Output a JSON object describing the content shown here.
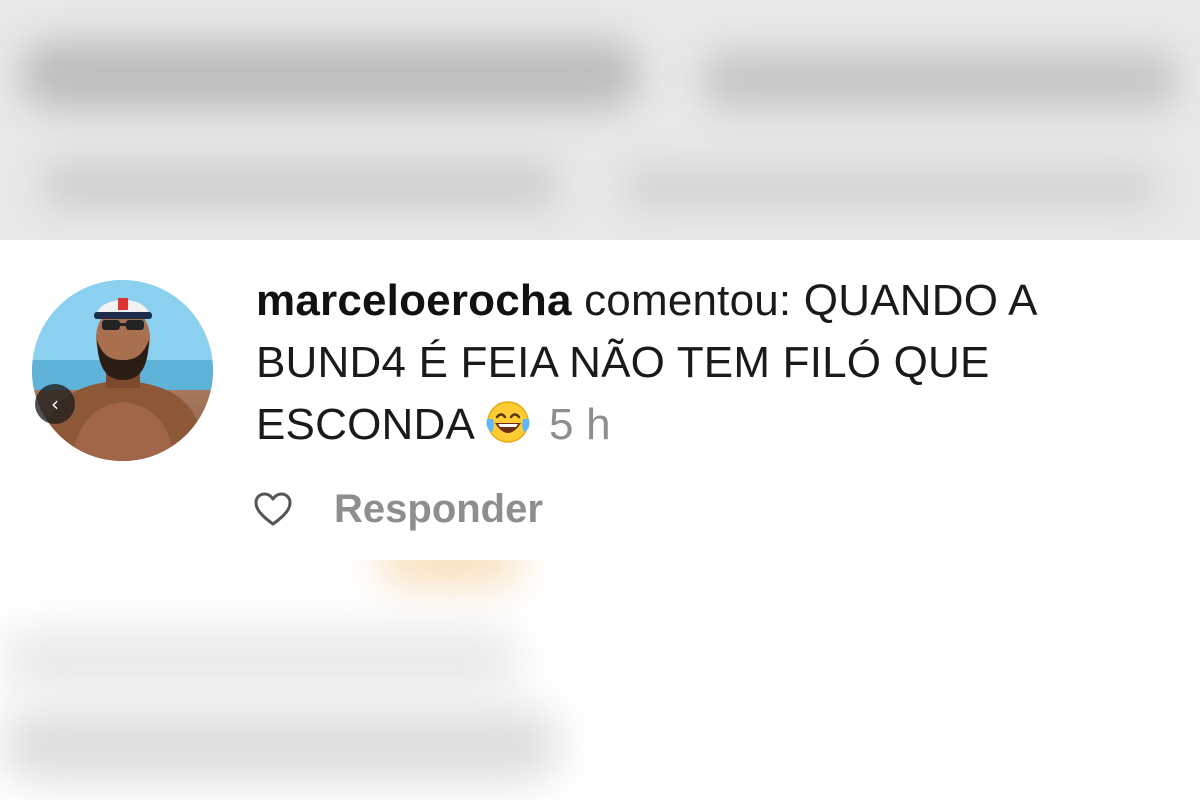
{
  "comment": {
    "username": "marceloerocha",
    "verb": "comentou:",
    "body": "QUANDO A BUND4 É FEIA NÃO TEM FILÓ QUE ESCONDA",
    "emoji": "face-with-tears-of-joy",
    "time": "5 h"
  },
  "actions": {
    "like_icon": "heart-icon",
    "reply_label": "Responder"
  },
  "avatar": {
    "nav_icon": "chevron-left-icon",
    "nav_glyph": "‹"
  },
  "colors": {
    "text": "#1a1a1a",
    "muted": "#8e8e8e",
    "background": "#ffffff"
  }
}
